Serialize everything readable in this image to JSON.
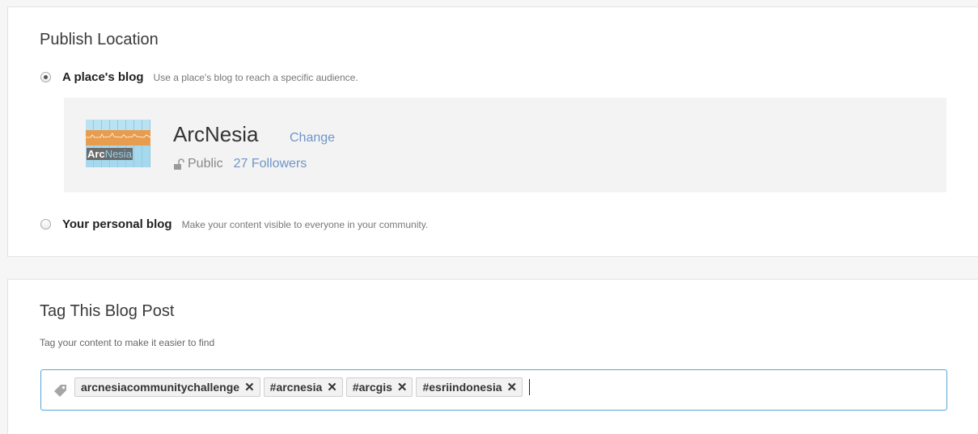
{
  "publish": {
    "title": "Publish Location",
    "options": [
      {
        "label": "A place's blog",
        "description": "Use a place's blog to reach a specific audience.",
        "checked": true
      },
      {
        "label": "Your personal blog",
        "description": "Make your content visible to everyone in your community.",
        "checked": false
      }
    ],
    "place": {
      "logo_text_a": "Arc",
      "logo_text_b": "Nesia",
      "name": "ArcNesia",
      "change_label": "Change",
      "visibility": "Public",
      "followers": "27 Followers"
    }
  },
  "tags": {
    "title": "Tag This Blog Post",
    "help": "Tag your content to make it easier to find",
    "remove_glyph": "✕",
    "items": [
      "arcnesiacommunitychallenge",
      "#arcnesia",
      "#arcgis",
      "#esriindonesia"
    ]
  },
  "colors": {
    "link": "#6f95c9",
    "input_focus_border": "#5aa4d6",
    "place_box_bg": "#f3f3f3",
    "logo_orange": "#e89c4e",
    "logo_blue": "#9fd5ec"
  },
  "icons": {
    "lock": "lock-open-icon",
    "tag": "tag-icon"
  }
}
